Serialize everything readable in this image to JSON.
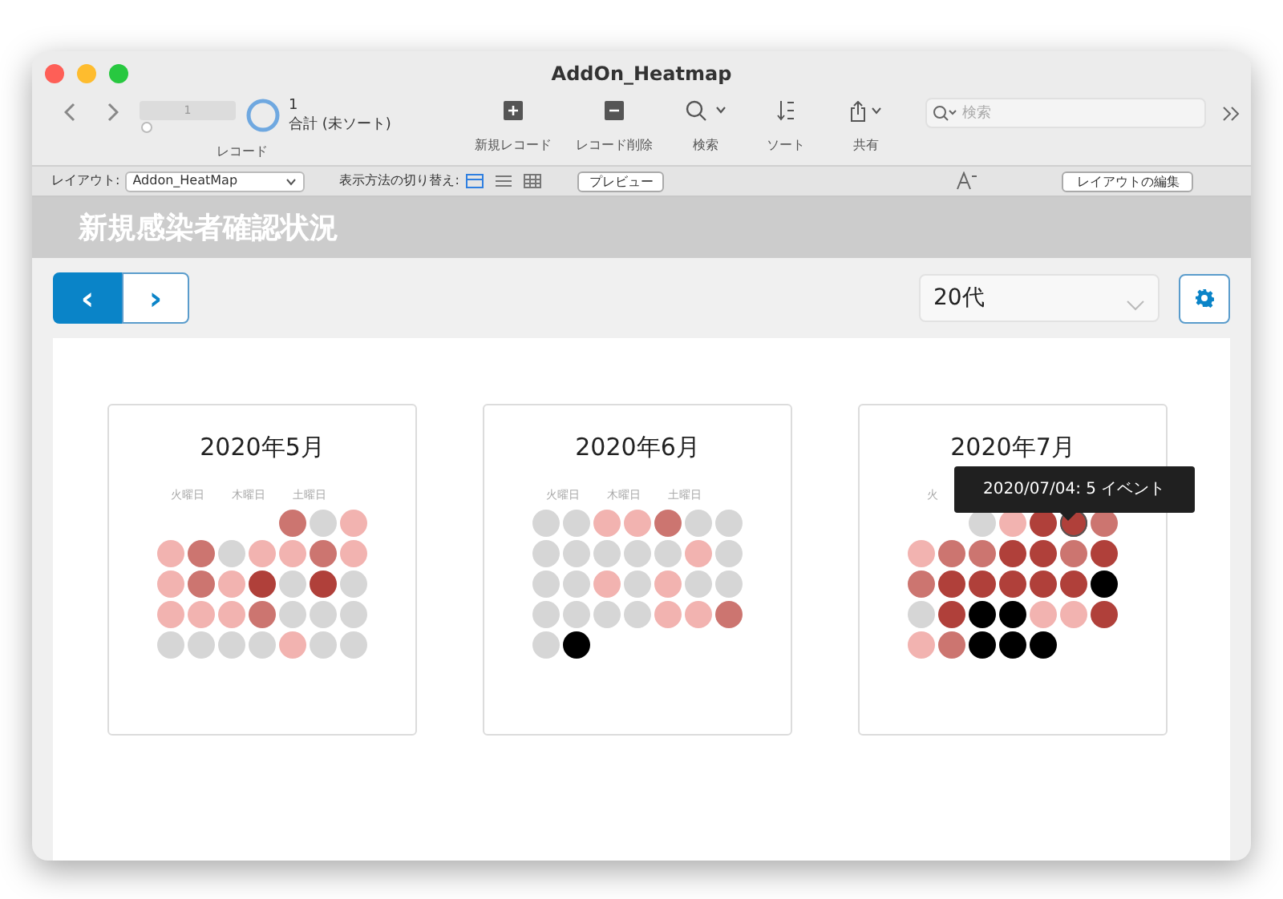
{
  "window": {
    "title": "AddOn_Heatmap"
  },
  "toolbar": {
    "record_slider": {
      "value": "1",
      "level": 0.02
    },
    "record_count": "1",
    "record_summary": "合計 (未ソート)",
    "record_label": "レコード",
    "buttons": [
      {
        "kind": "new",
        "label": "新規レコード"
      },
      {
        "kind": "delete",
        "label": "レコード削除"
      },
      {
        "kind": "find",
        "label": "検索"
      },
      {
        "kind": "sort",
        "label": "ソート"
      },
      {
        "kind": "share",
        "label": "共有"
      }
    ],
    "search": {
      "placeholder": "検索"
    }
  },
  "layout_bar": {
    "layout_label": "レイアウト:",
    "layout_value": "Addon_HeatMap",
    "view_label": "表示方法の切り替え:",
    "views": [
      {
        "kind": "form",
        "selected": true
      },
      {
        "kind": "list",
        "selected": false
      },
      {
        "kind": "table",
        "selected": false
      }
    ],
    "preview": "プレビュー",
    "edit_layout": "レイアウトの編集"
  },
  "header": {
    "title": "新規感染者確認状況"
  },
  "nav": {
    "prev": "‹",
    "next": "›",
    "age_select": "20代"
  },
  "months": [
    {
      "title": "2020年5月",
      "weekdays": [
        "火曜日",
        "木曜日",
        "土曜日"
      ],
      "weeks": [
        [
          {
            "kind": "empty"
          },
          {
            "kind": "empty"
          },
          {
            "kind": "empty"
          },
          {
            "kind": "empty"
          },
          {
            "kind": "day",
            "color": "#cc7570"
          },
          {
            "kind": "day",
            "color": "#d6d6d6"
          },
          {
            "kind": "day",
            "color": "#f2b3b0"
          }
        ],
        [
          {
            "kind": "day",
            "color": "#f2b3b0"
          },
          {
            "kind": "day",
            "color": "#cc7570"
          },
          {
            "kind": "day",
            "color": "#d6d6d6"
          },
          {
            "kind": "day",
            "color": "#f2b3b0"
          },
          {
            "kind": "day",
            "color": "#f2b3b0"
          },
          {
            "kind": "day",
            "color": "#cc7570"
          },
          {
            "kind": "day",
            "color": "#f2b3b0"
          }
        ],
        [
          {
            "kind": "day",
            "color": "#f2b3b0"
          },
          {
            "kind": "day",
            "color": "#cc7570"
          },
          {
            "kind": "day",
            "color": "#f2b3b0"
          },
          {
            "kind": "day",
            "color": "#b0403a"
          },
          {
            "kind": "day",
            "color": "#d6d6d6"
          },
          {
            "kind": "day",
            "color": "#b0403a"
          },
          {
            "kind": "day",
            "color": "#d6d6d6"
          }
        ],
        [
          {
            "kind": "day",
            "color": "#f2b3b0"
          },
          {
            "kind": "day",
            "color": "#f2b3b0"
          },
          {
            "kind": "day",
            "color": "#f2b3b0"
          },
          {
            "kind": "day",
            "color": "#cc7570"
          },
          {
            "kind": "day",
            "color": "#d6d6d6"
          },
          {
            "kind": "day",
            "color": "#d6d6d6"
          },
          {
            "kind": "day",
            "color": "#d6d6d6"
          }
        ],
        [
          {
            "kind": "day",
            "color": "#d6d6d6"
          },
          {
            "kind": "day",
            "color": "#d6d6d6"
          },
          {
            "kind": "day",
            "color": "#d6d6d6"
          },
          {
            "kind": "day",
            "color": "#d6d6d6"
          },
          {
            "kind": "day",
            "color": "#f2b3b0"
          },
          {
            "kind": "day",
            "color": "#d6d6d6"
          },
          {
            "kind": "day",
            "color": "#d6d6d6"
          }
        ]
      ]
    },
    {
      "title": "2020年6月",
      "weekdays": [
        "火曜日",
        "木曜日",
        "土曜日"
      ],
      "weeks": [
        [
          {
            "kind": "day",
            "color": "#d6d6d6"
          },
          {
            "kind": "day",
            "color": "#d6d6d6"
          },
          {
            "kind": "day",
            "color": "#f2b3b0"
          },
          {
            "kind": "day",
            "color": "#f2b3b0"
          },
          {
            "kind": "day",
            "color": "#cc7570"
          },
          {
            "kind": "day",
            "color": "#d6d6d6"
          },
          {
            "kind": "day",
            "color": "#d6d6d6"
          }
        ],
        [
          {
            "kind": "day",
            "color": "#d6d6d6"
          },
          {
            "kind": "day",
            "color": "#d6d6d6"
          },
          {
            "kind": "day",
            "color": "#d6d6d6"
          },
          {
            "kind": "day",
            "color": "#d6d6d6"
          },
          {
            "kind": "day",
            "color": "#d6d6d6"
          },
          {
            "kind": "day",
            "color": "#f2b3b0"
          },
          {
            "kind": "day",
            "color": "#d6d6d6"
          }
        ],
        [
          {
            "kind": "day",
            "color": "#d6d6d6"
          },
          {
            "kind": "day",
            "color": "#d6d6d6"
          },
          {
            "kind": "day",
            "color": "#f2b3b0"
          },
          {
            "kind": "day",
            "color": "#d6d6d6"
          },
          {
            "kind": "day",
            "color": "#f2b3b0"
          },
          {
            "kind": "day",
            "color": "#d6d6d6"
          },
          {
            "kind": "day",
            "color": "#d6d6d6"
          }
        ],
        [
          {
            "kind": "day",
            "color": "#d6d6d6"
          },
          {
            "kind": "day",
            "color": "#d6d6d6"
          },
          {
            "kind": "day",
            "color": "#d6d6d6"
          },
          {
            "kind": "day",
            "color": "#d6d6d6"
          },
          {
            "kind": "day",
            "color": "#f2b3b0"
          },
          {
            "kind": "day",
            "color": "#f2b3b0"
          },
          {
            "kind": "day",
            "color": "#cc7570"
          }
        ],
        [
          {
            "kind": "day",
            "color": "#d6d6d6"
          },
          {
            "kind": "day",
            "color": "#000000"
          }
        ]
      ]
    },
    {
      "title": "2020年7月",
      "weekdays": [
        "火"
      ],
      "tooltip": "2020/07/04: 5 イベント",
      "weeks": [
        [
          {
            "kind": "empty"
          },
          {
            "kind": "empty"
          },
          {
            "kind": "day",
            "color": "#d6d6d6"
          },
          {
            "kind": "day",
            "color": "#f2b3b0"
          },
          {
            "kind": "day",
            "color": "#b0403a"
          },
          {
            "kind": "day",
            "color": "#b0403a",
            "hovered": true
          },
          {
            "kind": "day",
            "color": "#cc7570"
          }
        ],
        [
          {
            "kind": "day",
            "color": "#f2b3b0"
          },
          {
            "kind": "day",
            "color": "#cc7570"
          },
          {
            "kind": "day",
            "color": "#cc7570"
          },
          {
            "kind": "day",
            "color": "#b0403a"
          },
          {
            "kind": "day",
            "color": "#b0403a"
          },
          {
            "kind": "day",
            "color": "#cc7570"
          },
          {
            "kind": "day",
            "color": "#b0403a"
          }
        ],
        [
          {
            "kind": "day",
            "color": "#cc7570"
          },
          {
            "kind": "day",
            "color": "#b0403a"
          },
          {
            "kind": "day",
            "color": "#b0403a"
          },
          {
            "kind": "day",
            "color": "#b0403a"
          },
          {
            "kind": "day",
            "color": "#b0403a"
          },
          {
            "kind": "day",
            "color": "#b0403a"
          },
          {
            "kind": "day",
            "color": "#000000"
          }
        ],
        [
          {
            "kind": "day",
            "color": "#d6d6d6"
          },
          {
            "kind": "day",
            "color": "#b0403a"
          },
          {
            "kind": "day",
            "color": "#000000"
          },
          {
            "kind": "day",
            "color": "#000000"
          },
          {
            "kind": "day",
            "color": "#f2b3b0"
          },
          {
            "kind": "day",
            "color": "#f2b3b0"
          },
          {
            "kind": "day",
            "color": "#b0403a"
          }
        ],
        [
          {
            "kind": "day",
            "color": "#f2b3b0"
          },
          {
            "kind": "day",
            "color": "#cc7570"
          },
          {
            "kind": "day",
            "color": "#000000"
          },
          {
            "kind": "day",
            "color": "#000000"
          },
          {
            "kind": "day",
            "color": "#000000"
          }
        ]
      ]
    }
  ]
}
